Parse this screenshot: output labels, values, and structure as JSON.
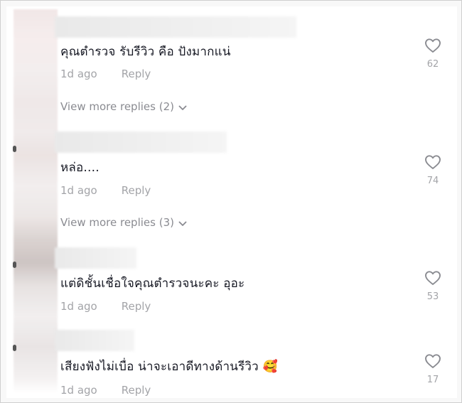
{
  "comments": [
    {
      "text": "คุณตำรวจ รับรีวิว คือ ปังมากแน่",
      "time": "1d ago",
      "reply": "Reply",
      "likes": "62",
      "more_replies": "View more replies (2)"
    },
    {
      "text": "หล่อ....",
      "time": "1d ago",
      "reply": "Reply",
      "likes": "74",
      "more_replies": "View more replies (3)"
    },
    {
      "text": "แต่ดิชั้นเชื่อใจคุณตำรวจนะคะ อุอะ",
      "time": "1d ago",
      "reply": "Reply",
      "likes": "53"
    },
    {
      "text": "เสียงฟังไม่เบื่อ น่าจะเอาดีทางด้านรีวิว",
      "emoji": "🥰",
      "time": "1d ago",
      "reply": "Reply",
      "likes": "17"
    }
  ],
  "colors": {
    "text": "#161823",
    "meta": "#a3a4a8",
    "link": "#8a8b91",
    "heart_stroke": "#8a8b91"
  },
  "icons": {
    "like": "heart-outline-icon",
    "expand": "chevron-down-icon"
  }
}
